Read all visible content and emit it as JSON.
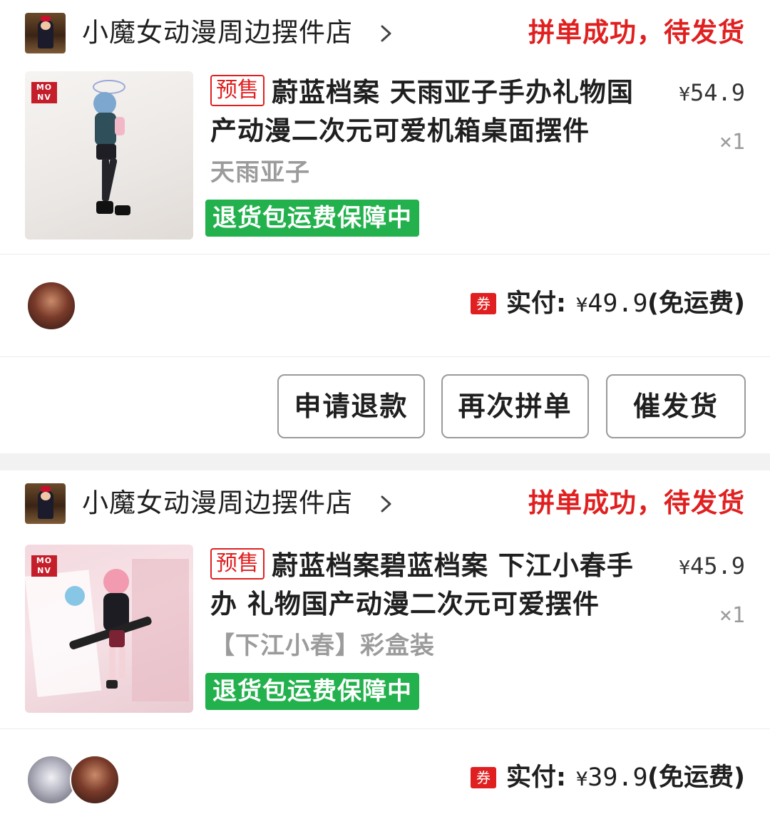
{
  "orders": [
    {
      "shop_name": "小魔女动漫周边摆件店",
      "status": "拼单成功，待发货",
      "presale_tag": "预售",
      "title": "蔚蓝档案 天雨亚子手办礼物国产动漫二次元可爱机箱桌面摆件",
      "spec": "天雨亚子",
      "guarantee": "退货包运费保障中",
      "brand_logo": "MO NV",
      "unit_price_symbol": "¥",
      "unit_price": "54.9",
      "quantity": "×1",
      "coupon_label": "券",
      "paid_label": "实付:",
      "paid_symbol": "¥",
      "paid_amount": "49.9",
      "shipping_note": "(免运费)",
      "actions": [
        "申请退款",
        "再次拼单",
        "催发货"
      ]
    },
    {
      "shop_name": "小魔女动漫周边摆件店",
      "status": "拼单成功，待发货",
      "presale_tag": "预售",
      "title": "蔚蓝档案碧蓝档案 下江小春手办 礼物国产动漫二次元可爱摆件",
      "spec": "【下江小春】彩盒装",
      "guarantee": "退货包运费保障中",
      "brand_logo": "MO NV",
      "unit_price_symbol": "¥",
      "unit_price": "45.9",
      "quantity": "×1",
      "coupon_label": "券",
      "paid_label": "实付:",
      "paid_symbol": "¥",
      "paid_amount": "39.9",
      "shipping_note": "(免运费)"
    }
  ],
  "colors": {
    "status_red": "#e02020",
    "guarantee_green": "#22b14c",
    "muted_gray": "#9b9b9b",
    "section_gap": "#f2f2f2"
  },
  "icons": [
    "chevron-right-icon",
    "coupon-icon"
  ]
}
